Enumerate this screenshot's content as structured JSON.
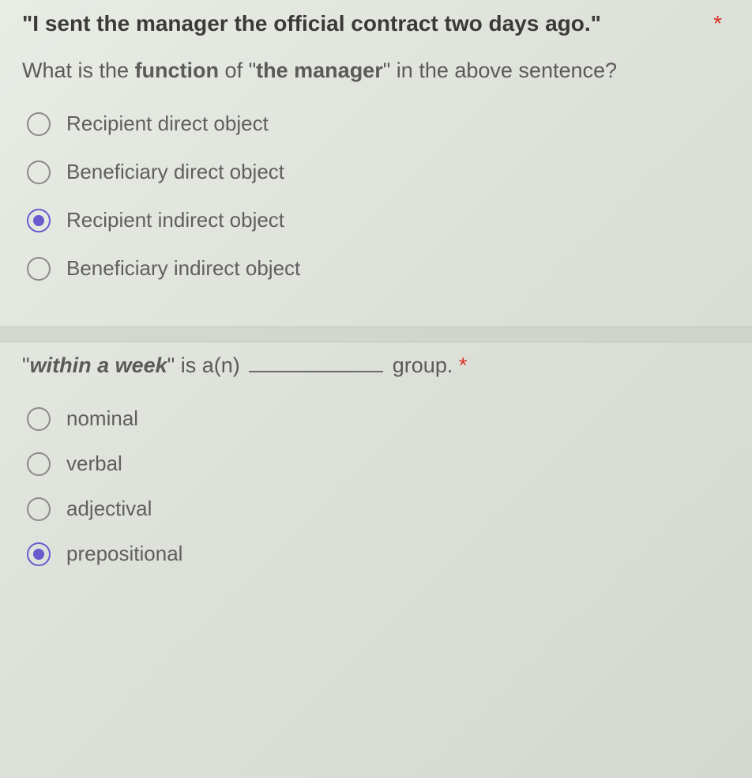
{
  "q1": {
    "sentence": "\"I sent the manager the official contract two days ago.\"",
    "required_mark": "*",
    "prompt_pre": "What is the ",
    "prompt_bold1": "function",
    "prompt_mid": " of \"",
    "prompt_bold2": "the manager",
    "prompt_post": "\" in the above sentence?",
    "options": [
      "Recipient direct object",
      "Beneficiary direct object",
      "Recipient indirect object",
      "Beneficiary indirect object"
    ],
    "selected_index": 2
  },
  "q2": {
    "quote_open": "\"",
    "phrase": "within a week",
    "quote_close": "\"",
    "mid": " is a(n) ",
    "tail": " group. ",
    "required_mark": "*",
    "options": [
      "nominal",
      "verbal",
      "adjectival",
      "prepositional"
    ],
    "selected_index": 3
  }
}
